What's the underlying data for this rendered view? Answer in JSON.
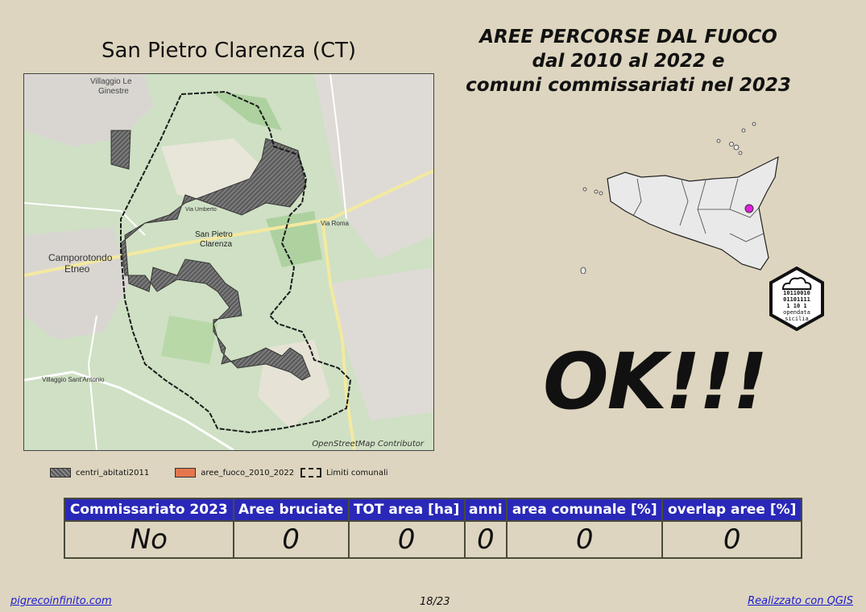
{
  "header": {
    "line1": "AREE PERCORSE DAL FUOCO",
    "line2": "dal 2010 al 2022 e",
    "line3": "comuni commissariati nel 2023"
  },
  "map": {
    "title": "San Pietro Clarenza (CT)",
    "attribution": "OpenStreetMap Contributor",
    "labels": {
      "camporotondo": "Camporotondo",
      "etneo": "Etneo",
      "villaggio": "Villaggio Le",
      "ginestre": "Ginestre",
      "san_pietro": "San Pietro",
      "clarenza": "Clarenza",
      "via_roma": "Via Roma",
      "via_umberto": "Via Umberto",
      "sant_antonio": "Villaggio Sant'Antonio"
    }
  },
  "legend": {
    "centri": "centri_abitati2011",
    "fuoco": "aree_fuoco_2010_2022",
    "limiti": "Limiti comunali"
  },
  "status": "OK!!!",
  "logo_text": {
    "line1": "10110010",
    "line2": "01101111",
    "line3": "1  10 1",
    "line4": "opendata",
    "line5": "sicilia"
  },
  "table": {
    "headers": [
      "Commissariato 2023",
      "Aree bruciate",
      "TOT area [ha]",
      "anni",
      "area comunale [%]",
      "overlap aree [%]"
    ],
    "row": [
      "No",
      "0",
      "0",
      "0",
      "0",
      "0"
    ]
  },
  "footer": {
    "left": "pigrecoinfinito.com",
    "page": "18/23",
    "right": "Realizzato con QGIS"
  },
  "colors": {
    "background": "#ddd5bf",
    "table_header": "#2a28b8",
    "link": "#1a1ad0",
    "marker": "#e020e0"
  }
}
